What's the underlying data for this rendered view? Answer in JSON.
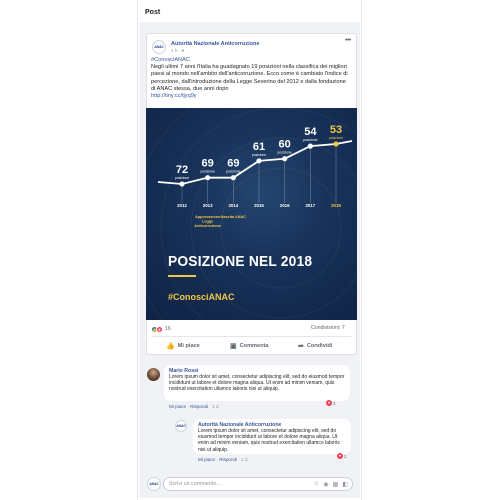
{
  "page": {
    "title": "Post"
  },
  "post": {
    "author": "Autorità Nazionale Anticorruzione",
    "time": "1 h",
    "hashtag": "#ConosciANAC",
    "text": "Negli ultimi 7 anni l'Italia ha guadagnato 19 posizioni nella classifica dei migliori paesi al mondo nell'ambito dell'anticorruzione. Ecco come è cambiato l'indice di percezione, dall'introduzione della Legge Severino del 2012 e dalla fondazione di ANAC stessa, due anni dopo",
    "link": "http://tiny.cc/tjyq9y",
    "avatar_text": "ANAC",
    "reactions_count": "16",
    "shares": "Condivisioni: 7",
    "actions": {
      "like": "Mi piace",
      "comment": "Commenta",
      "share": "Condividi"
    }
  },
  "chart_data": {
    "type": "line",
    "x": [
      "2012",
      "2013",
      "2014",
      "2015",
      "2016",
      "2017",
      "2018"
    ],
    "values": [
      72,
      69,
      69,
      61,
      60,
      54,
      53
    ],
    "value_suffix": "posizione",
    "highlight_last": true,
    "annotations": [
      {
        "x": "2013",
        "text": "Approvazione Legge Anticorruzione"
      },
      {
        "x": "2014",
        "text": "Nascita ANAC"
      }
    ],
    "title": "POSIZIONE NEL 2018",
    "hashtag": "#ConosciANAC",
    "colors": {
      "line": "#ffffff",
      "highlight": "#f2c744",
      "background": "#18325a"
    }
  },
  "comments": [
    {
      "author": "Mario Rossi",
      "text": "Lorem ipsum dolor sit amet, consectetur adipiscing elit, sed do eiusmod tempor incididunt ut labore et dolore magna aliqua. Ut enim ad minim veniam, quis nostrud exercitation ullamco laboris nisi ut aliquip.",
      "like": "Mi piace",
      "reply": "Rispondi",
      "time": "1 d",
      "likes": "2"
    },
    {
      "author": "Autorità Nazionale Anticorruzione",
      "text": "Lorem ipsum dolor sit amet, consectetur adipiscing elit, sed do eiusmod tempor incididunt ut labore et dolore magna aliqua. Ut enim ad minim veniam, quis nostrud exercitation ullamco laboris nisi ut aliquip.",
      "like": "Mi piace",
      "reply": "Rispondi",
      "time": "1 d",
      "likes": "2"
    }
  ],
  "composer": {
    "placeholder": "Scrivi un commento..."
  }
}
